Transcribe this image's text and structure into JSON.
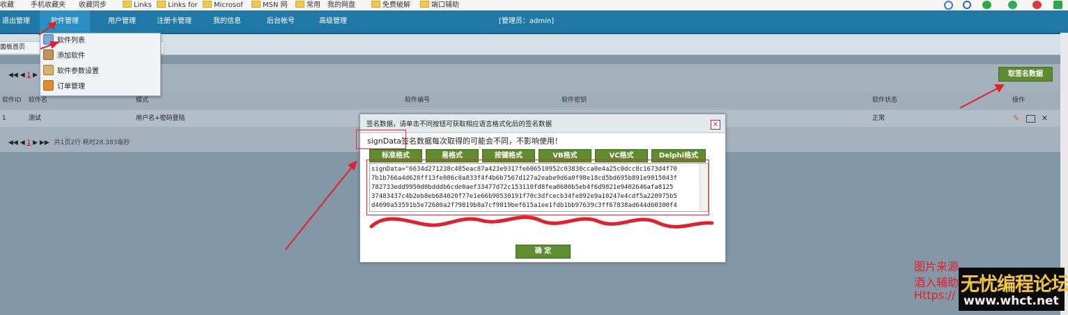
{
  "bookmarks": [
    "收藏",
    "手机收藏夹",
    "收藏同步",
    "Links",
    "Links for",
    "Microsof",
    "MSN 网",
    "常用",
    "我的网盘",
    "免费破解",
    "端口辅助"
  ],
  "nav": {
    "items": [
      "退出管理",
      "软件管理",
      "用户管理",
      "注册卡管理",
      "我的信息",
      "后台帐号",
      "高级管理"
    ],
    "active": "软件管理",
    "admin_label": "[管理员：admin]"
  },
  "tabs": [
    "面板首页"
  ],
  "dropdown": [
    "软件列表",
    "添加软件",
    "软件参数设置",
    "订单管理"
  ],
  "pager_top": {
    "controls": "◀◀ ◀",
    "page": "1",
    "more": "▶"
  },
  "pager_bottom": {
    "controls": "◀◀ ◀",
    "page": "1",
    "next": "▶ ▶▶",
    "summary": "共1页2行 耗时28.383毫秒"
  },
  "get_sign_button": "取签名数据",
  "table": {
    "headers": [
      "软件ID",
      "软件名",
      "模式",
      "软件编号",
      "软件密钥",
      "软件状态",
      "操作"
    ],
    "row": {
      "id": "1",
      "name": "测试",
      "mode": "用户名+密码登陆",
      "status": "正常"
    }
  },
  "modal": {
    "title": "签名数据，请单击不同按钮可获取相应语言格式化后的签名数据",
    "note": "signData签名数据每次取得的可能会不同，不影响使用！",
    "formats": [
      "标准格式",
      "易格式",
      "按键格式",
      "VB格式",
      "VC格式",
      "Delphi格式"
    ],
    "sig_lines": [
      "signData=\"6634d271238c485eac87a423e9317fe606510952c03830cca0e4a25c0dcc8c1673d4f70",
      "7b1b766a4d628ff13fe086c0a833f4f4b6b7567d127a2eabe9d6a0f98e18cd5bd695b891e9015043f",
      "782733edd9950d0bdddb6cde0aef33477d72c153110fd8fea0680b5eb4f6d9821e9402646afa8125",
      "37483437c4b2eb8eb684020f77e1e66b90530191f70c3dfcecb34fe892e9a10247e4cdf5a220975b5",
      "d4090a53591b5e72680a2f79819b8a7cf9819bef615a1ee1fdb1bb97639c3ff67838ad644d60300f4"
    ],
    "ok_label": "确 定",
    "close_label": "×"
  },
  "watermark": {
    "line1": "图片来源",
    "line2": "酒入辅助",
    "line3": "Https://",
    "logo_title": "无忧编程论坛",
    "logo_url": "www.whct.net"
  }
}
